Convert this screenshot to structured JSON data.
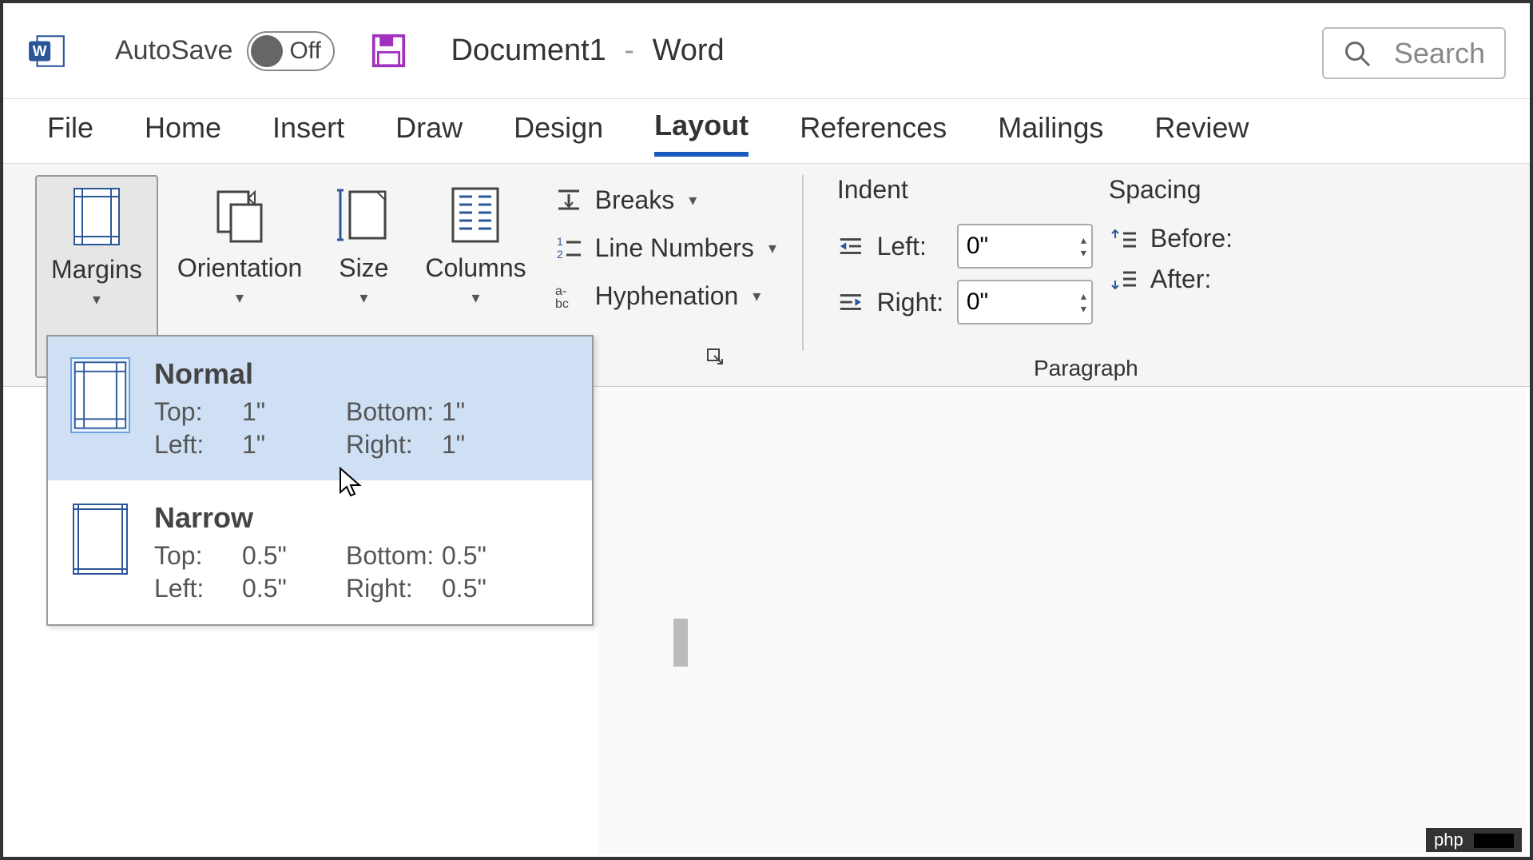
{
  "titlebar": {
    "autosave_label": "AutoSave",
    "autosave_state": "Off",
    "doc_name": "Document1",
    "app_name": "Word",
    "search_placeholder": "Search"
  },
  "tabs": {
    "file": "File",
    "home": "Home",
    "insert": "Insert",
    "draw": "Draw",
    "design": "Design",
    "layout": "Layout",
    "references": "References",
    "mailings": "Mailings",
    "review": "Review"
  },
  "ribbon": {
    "margins": "Margins",
    "orientation": "Orientation",
    "size": "Size",
    "columns": "Columns",
    "breaks": "Breaks",
    "line_numbers": "Line Numbers",
    "hyphenation": "Hyphenation",
    "indent_label": "Indent",
    "indent_left_label": "Left:",
    "indent_left_value": "0\"",
    "indent_right_label": "Right:",
    "indent_right_value": "0\"",
    "spacing_label": "Spacing",
    "spacing_before_label": "Before:",
    "spacing_after_label": "After:",
    "paragraph_group": "Paragraph"
  },
  "margins_menu": {
    "normal": {
      "name": "Normal",
      "top_lbl": "Top:",
      "top_val": "1\"",
      "bottom_lbl": "Bottom:",
      "bottom_val": "1\"",
      "left_lbl": "Left:",
      "left_val": "1\"",
      "right_lbl": "Right:",
      "right_val": "1\""
    },
    "narrow": {
      "name": "Narrow",
      "top_lbl": "Top:",
      "top_val": "0.5\"",
      "bottom_lbl": "Bottom:",
      "bottom_val": "0.5\"",
      "left_lbl": "Left:",
      "left_val": "0.5\"",
      "right_lbl": "Right:",
      "right_val": "0.5\""
    }
  },
  "watermark": "php"
}
